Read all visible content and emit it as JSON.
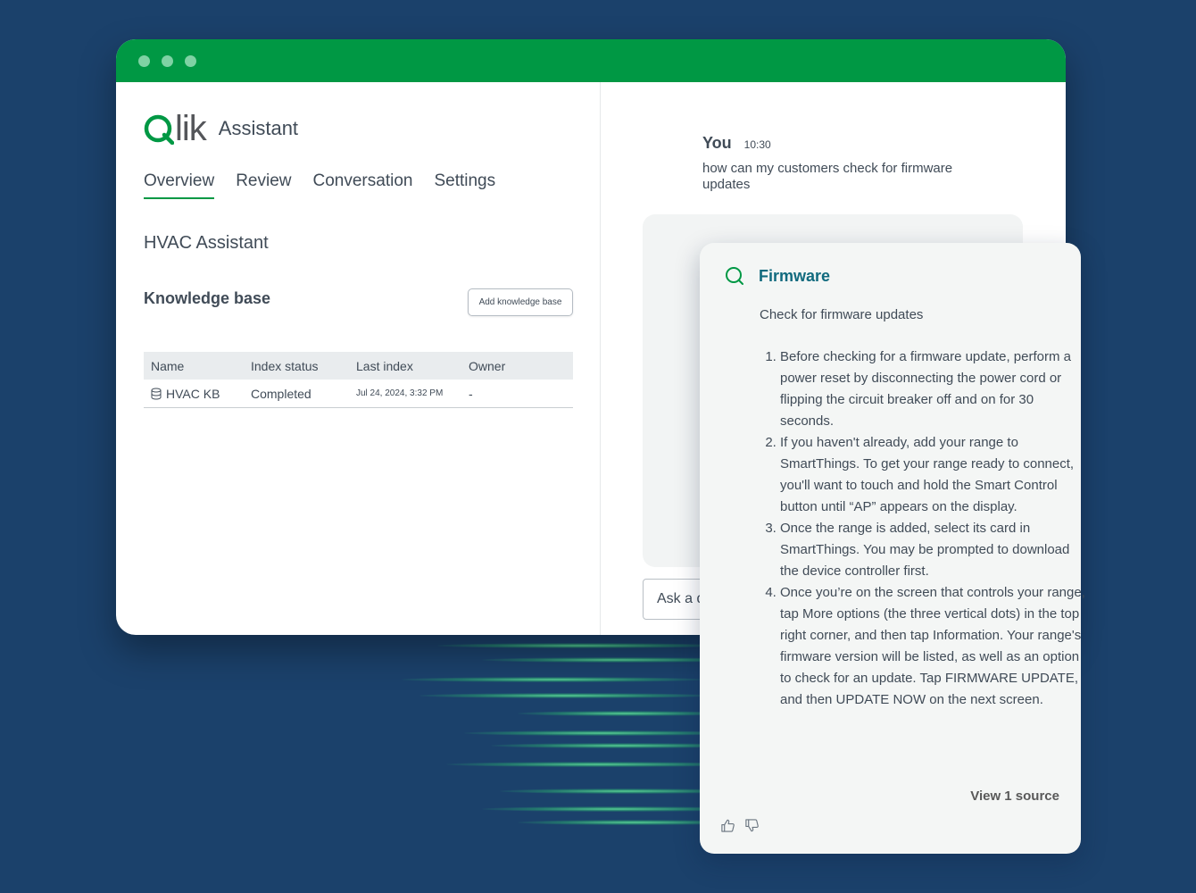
{
  "app": {
    "logo_text": "lik",
    "title": "Assistant"
  },
  "tabs": [
    {
      "label": "Overview",
      "active": true
    },
    {
      "label": "Review"
    },
    {
      "label": "Conversation"
    },
    {
      "label": "Settings"
    }
  ],
  "assistant_name": "HVAC Assistant",
  "knowledge_base": {
    "title": "Knowledge base",
    "add_button": "Add knowledge base",
    "columns": [
      "Name",
      "Index status",
      "Last index",
      "Owner"
    ],
    "rows": [
      {
        "name": "HVAC KB",
        "status": "Completed",
        "last_index": "Jul 24, 2024, 3:32 PM",
        "owner": "-"
      }
    ]
  },
  "chat": {
    "user_name": "You",
    "time": "10:30",
    "message": "how can my customers check for firmware updates",
    "input_placeholder": "Ask a question"
  },
  "answer": {
    "title": "Firmware",
    "subtitle": "Check for firmware updates",
    "steps": [
      "Before checking for a firmware update, perform a power reset by disconnecting the power cord or flipping the circuit breaker off and on for 30 seconds.",
      "If you haven't already, add your range to SmartThings. To get your range ready to connect, you'll want to touch and hold the Smart Control button until “AP” appears on the display.",
      "Once the range is added, select its card in SmartThings. You may be prompted to download the device controller first.",
      "Once you’re on the screen that controls your range, tap More options (the three vertical dots) in the top right corner, and then tap Information. Your range's firmware version will be listed, as well as an option to check for an update. Tap FIRMWARE UPDATE, and then UPDATE NOW on the next screen."
    ],
    "view_source": "View 1 source",
    "feedback_icons": [
      "thumbs-up-icon",
      "thumbs-down-icon"
    ]
  },
  "colors": {
    "background": "#1b416b",
    "brand_green": "#009844",
    "answer_title": "#116a7e"
  }
}
